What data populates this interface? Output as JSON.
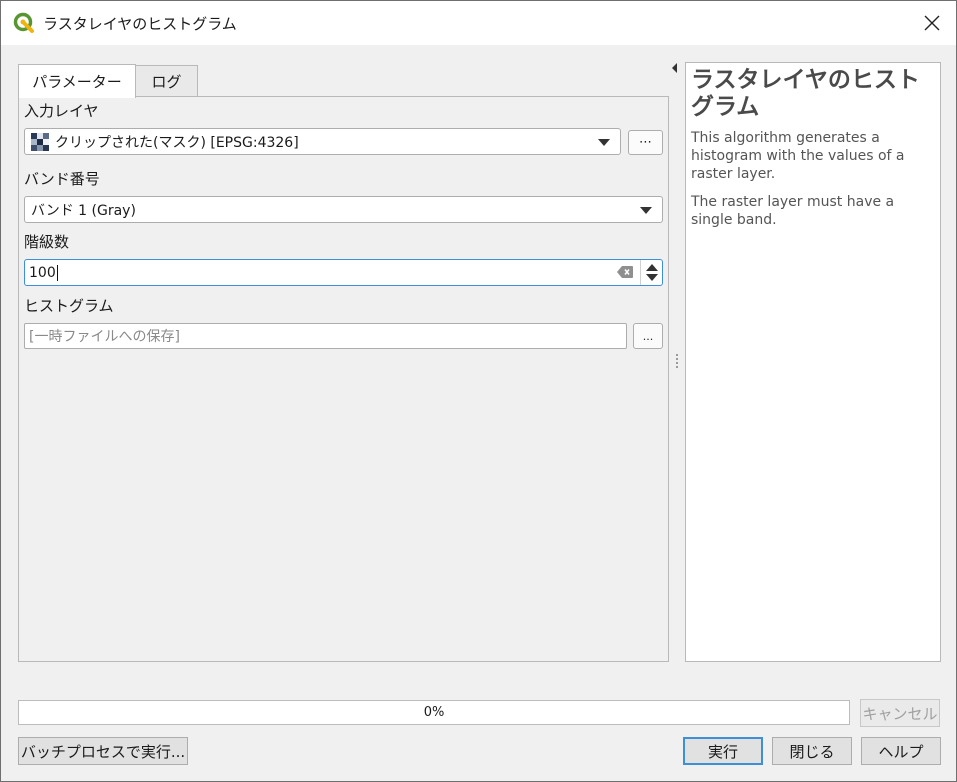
{
  "window": {
    "title": "ラスタレイヤのヒストグラム",
    "accent": "#589632"
  },
  "tabs": [
    {
      "label": "パラメーター",
      "active": true
    },
    {
      "label": "ログ",
      "active": false
    }
  ],
  "params": {
    "input_layer": {
      "label": "入力レイヤ",
      "value": "クリップされた(マスク) [EPSG:4326]",
      "browse_label": "⋯"
    },
    "band": {
      "label": "バンド番号",
      "value": "バンド 1 (Gray)"
    },
    "bins": {
      "label": "階級数",
      "value": "100"
    },
    "histogram": {
      "label": "ヒストグラム",
      "placeholder": "[一時ファイルへの保存]",
      "browse_label": "..."
    }
  },
  "help": {
    "title": "ラスタレイヤのヒストグラム",
    "paragraphs": [
      "This algorithm generates a histogram with the values of a raster layer.",
      "The raster layer must have a single band."
    ]
  },
  "progress": {
    "text": "0%",
    "value": 0
  },
  "buttons": {
    "cancel": "キャンセル",
    "batch": "バッチプロセスで実行...",
    "run": "実行",
    "close": "閉じる",
    "help": "ヘルプ"
  }
}
